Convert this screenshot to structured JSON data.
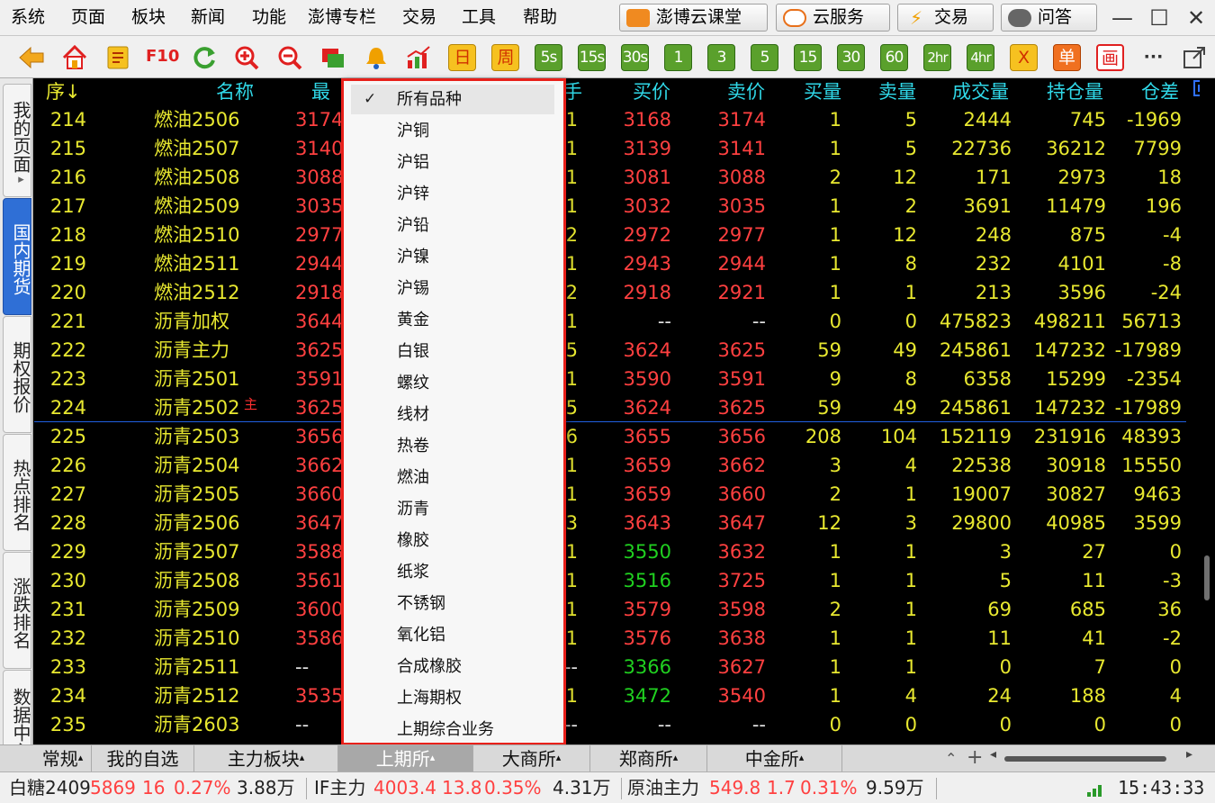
{
  "menu": [
    "系统",
    "页面",
    "板块",
    "新闻",
    "功能",
    "澎博专栏",
    "交易",
    "工具",
    "帮助"
  ],
  "top_buttons": [
    {
      "label": "澎博云课堂",
      "icon": "classroom-icon",
      "color": "#e8701a"
    },
    {
      "label": "云服务",
      "icon": "cloud-service-icon",
      "color": "#e8701a"
    },
    {
      "label": "交易",
      "icon": "lightning-icon",
      "color": "#f0a000"
    },
    {
      "label": "问答",
      "icon": "chat-bubble-icon",
      "color": "#606060"
    }
  ],
  "window_controls": {
    "minimize": "—",
    "maximize": "☐",
    "close": "✕"
  },
  "toolbar": {
    "periods_yellow": [
      "日",
      "周"
    ],
    "periods_green": [
      "5s",
      "15s",
      "30s",
      "1",
      "3",
      "5",
      "15",
      "30",
      "60",
      "2hr",
      "4hr"
    ],
    "extra": [
      "X",
      "单",
      "画",
      "···"
    ]
  },
  "side_tabs": [
    "我的页面",
    "国内期货",
    "期权报价",
    "热点排名",
    "涨跌排名",
    "数据中心"
  ],
  "side_tab_marker": "▸",
  "columns": {
    "seq": "序↓",
    "name": "名称",
    "last": "最新",
    "hand": "手",
    "bid": "买价",
    "ask": "卖价",
    "bid_vol": "买量",
    "ask_vol": "卖量",
    "volume": "成交量",
    "open_interest": "持仓量",
    "oi_change": "仓差"
  },
  "rows": [
    {
      "seq": "214",
      "name": "燃油2506",
      "last": "3174",
      "hand": "1",
      "bid": "3168",
      "ask": "3174",
      "bid_vol": "1",
      "ask_vol": "5",
      "volume": "2444",
      "oi": "745",
      "oi_change": "-1969"
    },
    {
      "seq": "215",
      "name": "燃油2507",
      "last": "3140",
      "hand": "1",
      "bid": "3139",
      "ask": "3141",
      "bid_vol": "1",
      "ask_vol": "5",
      "volume": "22736",
      "oi": "36212",
      "oi_change": "7799"
    },
    {
      "seq": "216",
      "name": "燃油2508",
      "last": "3088",
      "hand": "1",
      "bid": "3081",
      "ask": "3088",
      "bid_vol": "2",
      "ask_vol": "12",
      "volume": "171",
      "oi": "2973",
      "oi_change": "18"
    },
    {
      "seq": "217",
      "name": "燃油2509",
      "last": "3035",
      "hand": "1",
      "bid": "3032",
      "ask": "3035",
      "bid_vol": "1",
      "ask_vol": "2",
      "volume": "3691",
      "oi": "11479",
      "oi_change": "196"
    },
    {
      "seq": "218",
      "name": "燃油2510",
      "last": "2977",
      "hand": "2",
      "bid": "2972",
      "ask": "2977",
      "bid_vol": "1",
      "ask_vol": "12",
      "volume": "248",
      "oi": "875",
      "oi_change": "-4"
    },
    {
      "seq": "219",
      "name": "燃油2511",
      "last": "2944",
      "hand": "1",
      "bid": "2943",
      "ask": "2944",
      "bid_vol": "1",
      "ask_vol": "8",
      "volume": "232",
      "oi": "4101",
      "oi_change": "-8"
    },
    {
      "seq": "220",
      "name": "燃油2512",
      "last": "2918",
      "hand": "2",
      "bid": "2918",
      "ask": "2921",
      "bid_vol": "1",
      "ask_vol": "1",
      "volume": "213",
      "oi": "3596",
      "oi_change": "-24"
    },
    {
      "seq": "221",
      "name": "沥青加权",
      "last": "3644",
      "hand": "1",
      "bid": "--",
      "ask": "--",
      "bid_vol": "0",
      "ask_vol": "0",
      "volume": "475823",
      "oi": "498211",
      "oi_change": "56713"
    },
    {
      "seq": "222",
      "name": "沥青主力",
      "last": "3625",
      "hand": "5",
      "bid": "3624",
      "ask": "3625",
      "bid_vol": "59",
      "ask_vol": "49",
      "volume": "245861",
      "oi": "147232",
      "oi_change": "-17989"
    },
    {
      "seq": "223",
      "name": "沥青2501",
      "last": "3591",
      "hand": "1",
      "bid": "3590",
      "ask": "3591",
      "bid_vol": "9",
      "ask_vol": "8",
      "volume": "6358",
      "oi": "15299",
      "oi_change": "-2354"
    },
    {
      "seq": "224",
      "name": "沥青2502",
      "badge": "主",
      "last": "3625",
      "hand": "5",
      "bid": "3624",
      "ask": "3625",
      "bid_vol": "59",
      "ask_vol": "49",
      "volume": "245861",
      "oi": "147232",
      "oi_change": "-17989"
    },
    {
      "seq": "225",
      "name": "沥青2503",
      "last": "3656",
      "hand": "6",
      "bid": "3655",
      "ask": "3656",
      "bid_vol": "208",
      "ask_vol": "104",
      "volume": "152119",
      "oi": "231916",
      "oi_change": "48393"
    },
    {
      "seq": "226",
      "name": "沥青2504",
      "last": "3662",
      "hand": "1",
      "bid": "3659",
      "ask": "3662",
      "bid_vol": "3",
      "ask_vol": "4",
      "volume": "22538",
      "oi": "30918",
      "oi_change": "15550"
    },
    {
      "seq": "227",
      "name": "沥青2505",
      "last": "3660",
      "hand": "1",
      "bid": "3659",
      "ask": "3660",
      "bid_vol": "2",
      "ask_vol": "1",
      "volume": "19007",
      "oi": "30827",
      "oi_change": "9463"
    },
    {
      "seq": "228",
      "name": "沥青2506",
      "last": "3647",
      "hand": "3",
      "bid": "3643",
      "ask": "3647",
      "bid_vol": "12",
      "ask_vol": "3",
      "volume": "29800",
      "oi": "40985",
      "oi_change": "3599"
    },
    {
      "seq": "229",
      "name": "沥青2507",
      "last": "3588",
      "hand": "1",
      "bid": "3550",
      "bid_color": "green",
      "ask": "3632",
      "bid_vol": "1",
      "ask_vol": "1",
      "volume": "3",
      "oi": "27",
      "oi_change": "0"
    },
    {
      "seq": "230",
      "name": "沥青2508",
      "last": "3561",
      "hand": "1",
      "bid": "3516",
      "bid_color": "green",
      "ask": "3725",
      "bid_vol": "1",
      "ask_vol": "1",
      "volume": "5",
      "oi": "11",
      "oi_change": "-3"
    },
    {
      "seq": "231",
      "name": "沥青2509",
      "last": "3600",
      "hand": "1",
      "bid": "3579",
      "ask": "3598",
      "bid_vol": "2",
      "ask_vol": "1",
      "volume": "69",
      "oi": "685",
      "oi_change": "36"
    },
    {
      "seq": "232",
      "name": "沥青2510",
      "last": "3586",
      "hand": "1",
      "bid": "3576",
      "ask": "3638",
      "bid_vol": "1",
      "ask_vol": "1",
      "volume": "11",
      "oi": "41",
      "oi_change": "-2"
    },
    {
      "seq": "233",
      "name": "沥青2511",
      "last": "--",
      "hand": "--",
      "bid": "3366",
      "bid_color": "green",
      "ask": "3627",
      "bid_vol": "1",
      "ask_vol": "1",
      "volume": "0",
      "oi": "7",
      "oi_change": "0"
    },
    {
      "seq": "234",
      "name": "沥青2512",
      "last": "3535",
      "hand": "1",
      "bid": "3472",
      "bid_color": "green",
      "ask": "3540",
      "bid_vol": "1",
      "ask_vol": "4",
      "volume": "24",
      "oi": "188",
      "oi_change": "4"
    },
    {
      "seq": "235",
      "name": "沥青2603",
      "last": "--",
      "hand": "--",
      "bid": "--",
      "ask": "--",
      "bid_vol": "0",
      "ask_vol": "0",
      "volume": "0",
      "oi": "0",
      "oi_change": "0"
    }
  ],
  "dropdown": {
    "selected": "所有品种",
    "check": "✓",
    "items": [
      "所有品种",
      "沪铜",
      "沪铝",
      "沪锌",
      "沪铅",
      "沪镍",
      "沪锡",
      "黄金",
      "白银",
      "螺纹",
      "线材",
      "热卷",
      "燃油",
      "沥青",
      "橡胶",
      "纸浆",
      "不锈钢",
      "氧化铝",
      "合成橡胶",
      "上海期权",
      "上期综合业务"
    ]
  },
  "bottom_tabs": [
    {
      "label": "常规",
      "arrow": "▴"
    },
    {
      "label": "我的自选",
      "arrow": ""
    },
    {
      "label": "主力板块",
      "arrow": "▴"
    },
    {
      "label": "上期所",
      "arrow": "▴",
      "active": true
    },
    {
      "label": "大商所",
      "arrow": "▴"
    },
    {
      "label": "郑商所",
      "arrow": "▴"
    },
    {
      "label": "中金所",
      "arrow": "▴"
    }
  ],
  "bottom_controls": {
    "collapse": "⌃",
    "add": "+",
    "left": "◂",
    "right": "▸"
  },
  "status": [
    {
      "name": "白糖2409",
      "price": "5869",
      "change": "16",
      "pct": "0.27%",
      "vol": "3.88万"
    },
    {
      "name": "IF主力",
      "price": "4003.4",
      "change": "13.8",
      "pct": "0.35%",
      "vol": "4.31万"
    },
    {
      "name": "原油主力",
      "price": "549.8",
      "change": "1.7",
      "pct": "0.31%",
      "vol": "9.59万"
    }
  ],
  "clock": "15:43:33",
  "colors": {
    "up": "#ff4040",
    "down": "#20d020",
    "neutral": "#e8e830",
    "header_cyan": "#30d8e8",
    "highlight_border": "#e8201a"
  }
}
